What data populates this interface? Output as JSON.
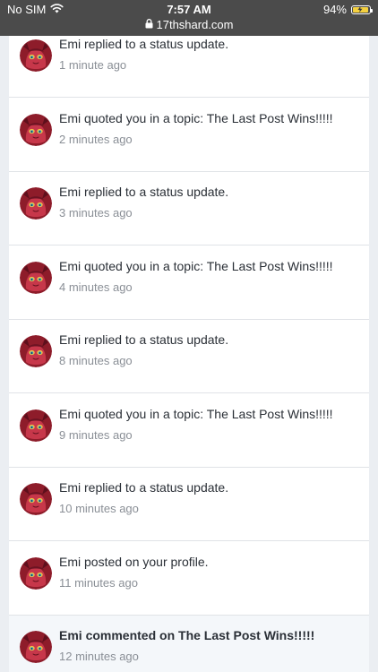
{
  "status_bar": {
    "carrier": "No SIM",
    "time": "7:57 AM",
    "url": "17thshard.com",
    "battery": "94%",
    "battery_level": 0.94,
    "icons": [
      "wifi-icon",
      "lock-icon",
      "battery-icon",
      "charging-bolt-icon"
    ]
  },
  "notifications": [
    {
      "title": "Emi replied to a status update.",
      "time": "1 minute ago",
      "unread": false
    },
    {
      "title": "Emi quoted you in a topic: The Last Post Wins!!!!!",
      "time": "2 minutes ago",
      "unread": false
    },
    {
      "title": "Emi replied to a status update.",
      "time": "3 minutes ago",
      "unread": false
    },
    {
      "title": "Emi quoted you in a topic: The Last Post Wins!!!!!",
      "time": "4 minutes ago",
      "unread": false
    },
    {
      "title": "Emi replied to a status update.",
      "time": "8 minutes ago",
      "unread": false
    },
    {
      "title": "Emi quoted you in a topic: The Last Post Wins!!!!!",
      "time": "9 minutes ago",
      "unread": false
    },
    {
      "title": "Emi replied to a status update.",
      "time": "10 minutes ago",
      "unread": false
    },
    {
      "title": "Emi posted on your profile.",
      "time": "11 minutes ago",
      "unread": false
    },
    {
      "title": "Emi commented on The Last Post Wins!!!!!",
      "time": "12 minutes ago",
      "unread": true
    }
  ],
  "colors": {
    "status_bar_bg": "#4b4b4b",
    "page_bg": "#ebeef2",
    "card_bg": "#ffffff",
    "unread_bg": "#f4f7fa",
    "title_text": "#2a2f36",
    "time_text": "#8a8f96",
    "avatar_bg": "#8e1c2a"
  }
}
